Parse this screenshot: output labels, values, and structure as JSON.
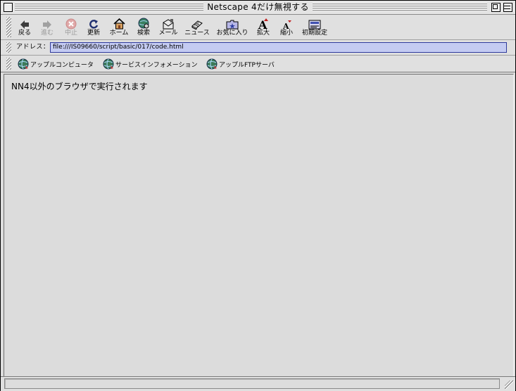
{
  "window": {
    "title": "Netscape 4だけ無視する"
  },
  "toolbar": {
    "buttons": [
      {
        "label": "戻る",
        "icon": "back-arrow-icon",
        "enabled": true
      },
      {
        "label": "進む",
        "icon": "forward-arrow-icon",
        "enabled": false
      },
      {
        "label": "中止",
        "icon": "stop-icon",
        "enabled": false
      },
      {
        "label": "更新",
        "icon": "reload-icon",
        "enabled": true
      },
      {
        "label": "ホーム",
        "icon": "home-icon",
        "enabled": true
      },
      {
        "label": "検索",
        "icon": "search-globe-icon",
        "enabled": true
      },
      {
        "label": "メール",
        "icon": "mail-icon",
        "enabled": true
      },
      {
        "label": "ニュース",
        "icon": "news-icon",
        "enabled": true
      },
      {
        "label": "お気に入り",
        "icon": "favorites-icon",
        "enabled": true
      },
      {
        "label": "拡大",
        "icon": "text-larger-icon",
        "enabled": true
      },
      {
        "label": "縮小",
        "icon": "text-smaller-icon",
        "enabled": true
      },
      {
        "label": "初期設定",
        "icon": "preferences-icon",
        "enabled": true
      }
    ]
  },
  "location": {
    "label": "アドレス：",
    "url": "file:///IS09660/script/basic/017/code.html"
  },
  "personal": {
    "items": [
      {
        "label": "アップルコンピュータ",
        "icon": "globe-icon"
      },
      {
        "label": "サービスインフォメーション",
        "icon": "globe-icon"
      },
      {
        "label": "アップルFTPサーバ",
        "icon": "globe-icon"
      }
    ]
  },
  "content": {
    "text": "NN4以外のブラウザで実行されます"
  },
  "status": {
    "text": ""
  }
}
